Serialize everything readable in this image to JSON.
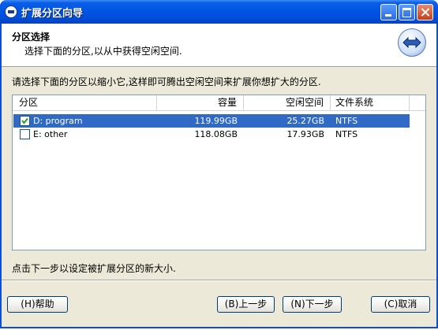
{
  "window": {
    "title": "扩展分区向导"
  },
  "header": {
    "title": "分区选择",
    "subtitle": "选择下面的分区,以从中获得空闲空间."
  },
  "instruction": "请选择下面的分区以缩小它,这样即可腾出空闲空间来扩展你想扩大的分区.",
  "table": {
    "columns": [
      "分区",
      "容量",
      "空闲空间",
      "文件系统"
    ],
    "rows": [
      {
        "name": "D: program",
        "capacity": "119.99GB",
        "free": "25.27GB",
        "fs": "NTFS",
        "checked": true,
        "selected": true
      },
      {
        "name": "E: other",
        "capacity": "118.08GB",
        "free": "17.93GB",
        "fs": "NTFS",
        "checked": false,
        "selected": false
      }
    ]
  },
  "footer_text": "点击下一步以设定被扩展分区的新大小.",
  "buttons": {
    "help": "(H)帮助",
    "back": "(B)上一步",
    "next": "(N)下一步",
    "cancel": "(C)取消"
  },
  "colors": {
    "titlebar": "#0054e3",
    "selection": "#316ac5",
    "dialog_bg": "#ece9d8"
  }
}
